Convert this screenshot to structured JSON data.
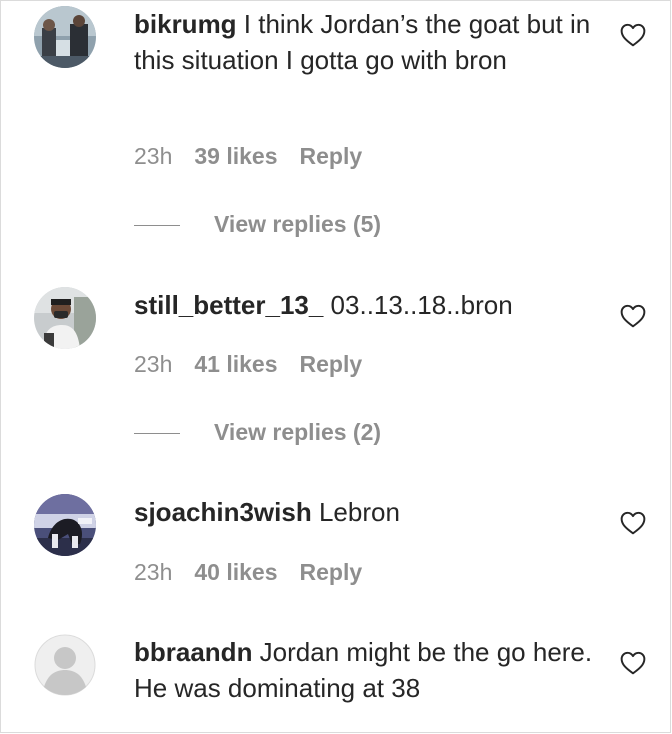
{
  "comments": [
    {
      "username": "bikrumg",
      "text": " I think Jordan’s the goat but in this situation I gotta go with bron",
      "time": "23h",
      "likes": "39 likes",
      "reply": "Reply",
      "view_replies": "View replies (5)",
      "avatar_icon": "user-photo-avatar",
      "like_icon": "heart-outline-icon"
    },
    {
      "username": "still_better_13_",
      "text": " 03..13..18..bron",
      "time": "23h",
      "likes": "41 likes",
      "reply": "Reply",
      "view_replies": "View replies (2)",
      "avatar_icon": "user-photo-avatar",
      "like_icon": "heart-outline-icon"
    },
    {
      "username": "sjoachin3wish",
      "text": " Lebron",
      "time": "23h",
      "likes": "40 likes",
      "reply": "Reply",
      "avatar_icon": "user-photo-avatar",
      "like_icon": "heart-outline-icon"
    },
    {
      "username": "bbraandn",
      "text": " Jordan might be the go here. He was dominating at 38",
      "avatar_icon": "default-avatar",
      "like_icon": "heart-outline-icon"
    }
  ],
  "colors": {
    "text": "#262626",
    "secondary": "#8e8e8e",
    "border": "#dbdbdb"
  }
}
